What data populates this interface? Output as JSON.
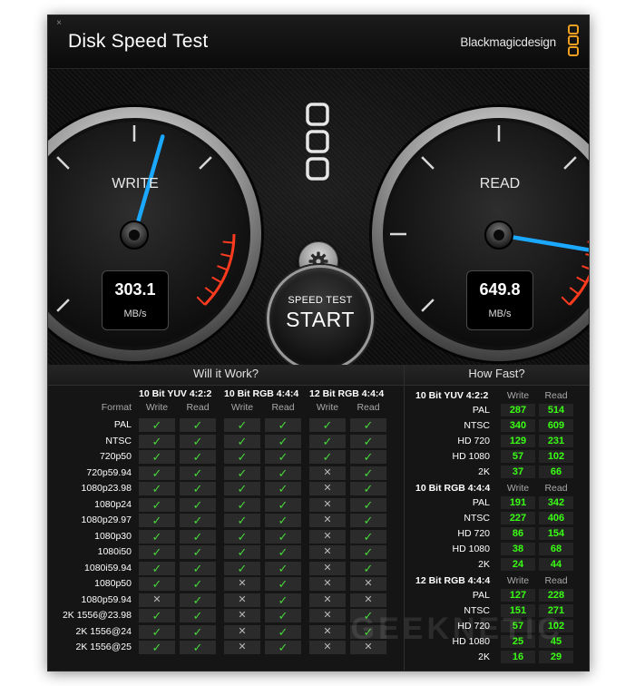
{
  "window": {
    "title": "Disk Speed Test",
    "brand": "Blackmagicdesign",
    "close_glyph": "×"
  },
  "gauges": {
    "write": {
      "label": "WRITE",
      "value": "303.1",
      "unit": "MB/s",
      "needle_fraction": 0.56
    },
    "read": {
      "label": "READ",
      "value": "649.8",
      "unit": "MB/s",
      "needle_fraction": 0.87
    }
  },
  "start_button": {
    "top": "SPEED TEST",
    "main": "START"
  },
  "icons": {
    "settings": "gear-icon",
    "logo": "blackmagic-logo-icon"
  },
  "colors": {
    "needle": "#1aa9ff",
    "redzone": "#ff3b1f",
    "check": "#47d63a",
    "number": "#39ff14"
  },
  "will_it_work": {
    "title": "Will it Work?",
    "format_label": "Format",
    "groups": [
      "10 Bit YUV 4:2:2",
      "10 Bit RGB 4:4:4",
      "12 Bit RGB 4:4:4"
    ],
    "sub": [
      "Write",
      "Read",
      "Write",
      "Read",
      "Write",
      "Read"
    ],
    "rows": [
      {
        "name": "PAL",
        "v": [
          1,
          1,
          1,
          1,
          1,
          1
        ]
      },
      {
        "name": "NTSC",
        "v": [
          1,
          1,
          1,
          1,
          1,
          1
        ]
      },
      {
        "name": "720p50",
        "v": [
          1,
          1,
          1,
          1,
          1,
          1
        ]
      },
      {
        "name": "720p59.94",
        "v": [
          1,
          1,
          1,
          1,
          0,
          1
        ]
      },
      {
        "name": "1080p23.98",
        "v": [
          1,
          1,
          1,
          1,
          0,
          1
        ]
      },
      {
        "name": "1080p24",
        "v": [
          1,
          1,
          1,
          1,
          0,
          1
        ]
      },
      {
        "name": "1080p29.97",
        "v": [
          1,
          1,
          1,
          1,
          0,
          1
        ]
      },
      {
        "name": "1080p30",
        "v": [
          1,
          1,
          1,
          1,
          0,
          1
        ]
      },
      {
        "name": "1080i50",
        "v": [
          1,
          1,
          1,
          1,
          0,
          1
        ]
      },
      {
        "name": "1080i59.94",
        "v": [
          1,
          1,
          1,
          1,
          0,
          1
        ]
      },
      {
        "name": "1080p50",
        "v": [
          1,
          1,
          0,
          1,
          0,
          0
        ]
      },
      {
        "name": "1080p59.94",
        "v": [
          0,
          1,
          0,
          1,
          0,
          0
        ]
      },
      {
        "name": "2K 1556@23.98",
        "v": [
          1,
          1,
          0,
          1,
          0,
          1
        ]
      },
      {
        "name": "2K 1556@24",
        "v": [
          1,
          1,
          0,
          1,
          0,
          1
        ]
      },
      {
        "name": "2K 1556@25",
        "v": [
          1,
          1,
          0,
          1,
          0,
          0
        ]
      }
    ],
    "check_glyph": "✓",
    "cross_glyph": "✕"
  },
  "how_fast": {
    "title": "How Fast?",
    "sections": [
      {
        "header": "10 Bit YUV 4:2:2",
        "write_label": "Write",
        "read_label": "Read",
        "rows": [
          {
            "name": "PAL",
            "write": "287",
            "read": "514"
          },
          {
            "name": "NTSC",
            "write": "340",
            "read": "609"
          },
          {
            "name": "HD 720",
            "write": "129",
            "read": "231"
          },
          {
            "name": "HD 1080",
            "write": "57",
            "read": "102"
          },
          {
            "name": "2K",
            "write": "37",
            "read": "66"
          }
        ]
      },
      {
        "header": "10 Bit RGB 4:4:4",
        "write_label": "Write",
        "read_label": "Read",
        "rows": [
          {
            "name": "PAL",
            "write": "191",
            "read": "342"
          },
          {
            "name": "NTSC",
            "write": "227",
            "read": "406"
          },
          {
            "name": "HD 720",
            "write": "86",
            "read": "154"
          },
          {
            "name": "HD 1080",
            "write": "38",
            "read": "68"
          },
          {
            "name": "2K",
            "write": "24",
            "read": "44"
          }
        ]
      },
      {
        "header": "12 Bit RGB 4:4:4",
        "write_label": "Write",
        "read_label": "Read",
        "rows": [
          {
            "name": "PAL",
            "write": "127",
            "read": "228"
          },
          {
            "name": "NTSC",
            "write": "151",
            "read": "271"
          },
          {
            "name": "HD 720",
            "write": "57",
            "read": "102"
          },
          {
            "name": "HD 1080",
            "write": "25",
            "read": "45"
          },
          {
            "name": "2K",
            "write": "16",
            "read": "29"
          }
        ]
      }
    ]
  },
  "watermark": "GEEKNETIC"
}
